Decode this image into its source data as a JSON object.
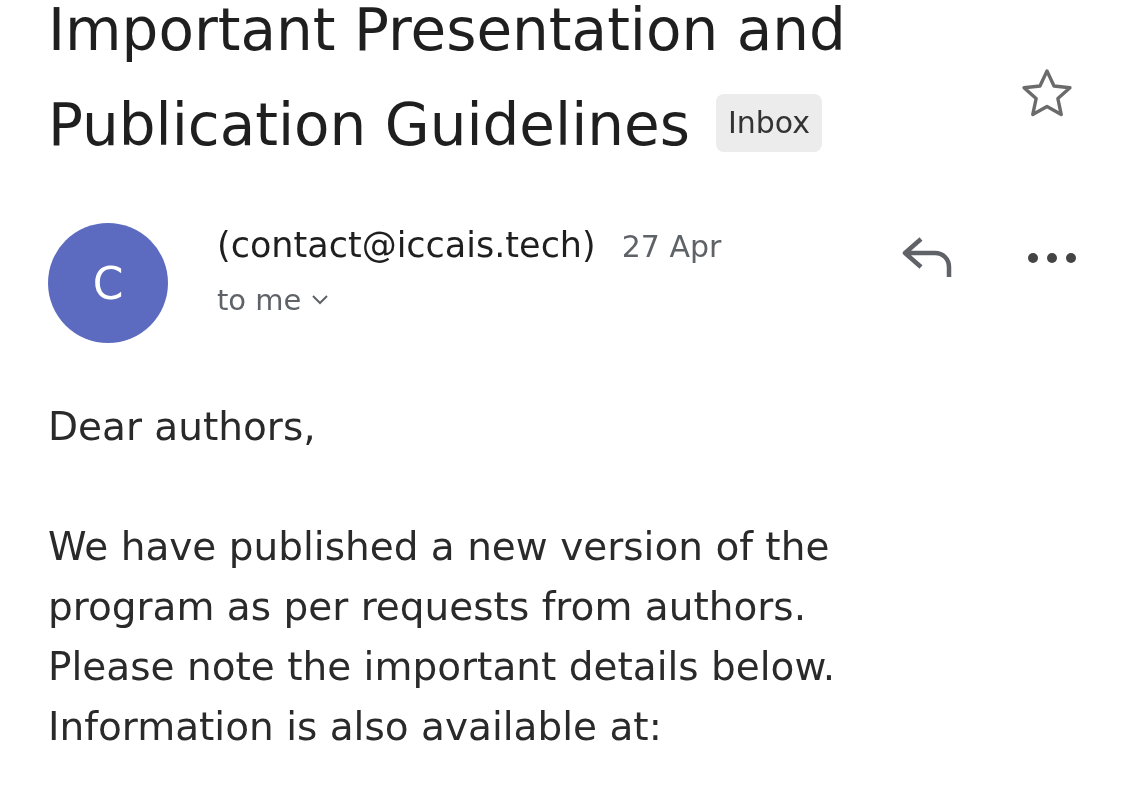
{
  "subject": {
    "title_lines": [
      "Important Presentation and",
      "Publication Guidelines"
    ],
    "label": "Inbox",
    "starred": false
  },
  "message": {
    "avatar_letter": "C",
    "sender": "(contact@iccais.tech)",
    "date": "27 Apr",
    "recipient": "to me",
    "greeting": "Dear authors,",
    "paragraph_lines": [
      "We have published a new version of the",
      "program as per requests from authors.",
      "Please note the important details below.",
      "Information is also available at:"
    ]
  }
}
